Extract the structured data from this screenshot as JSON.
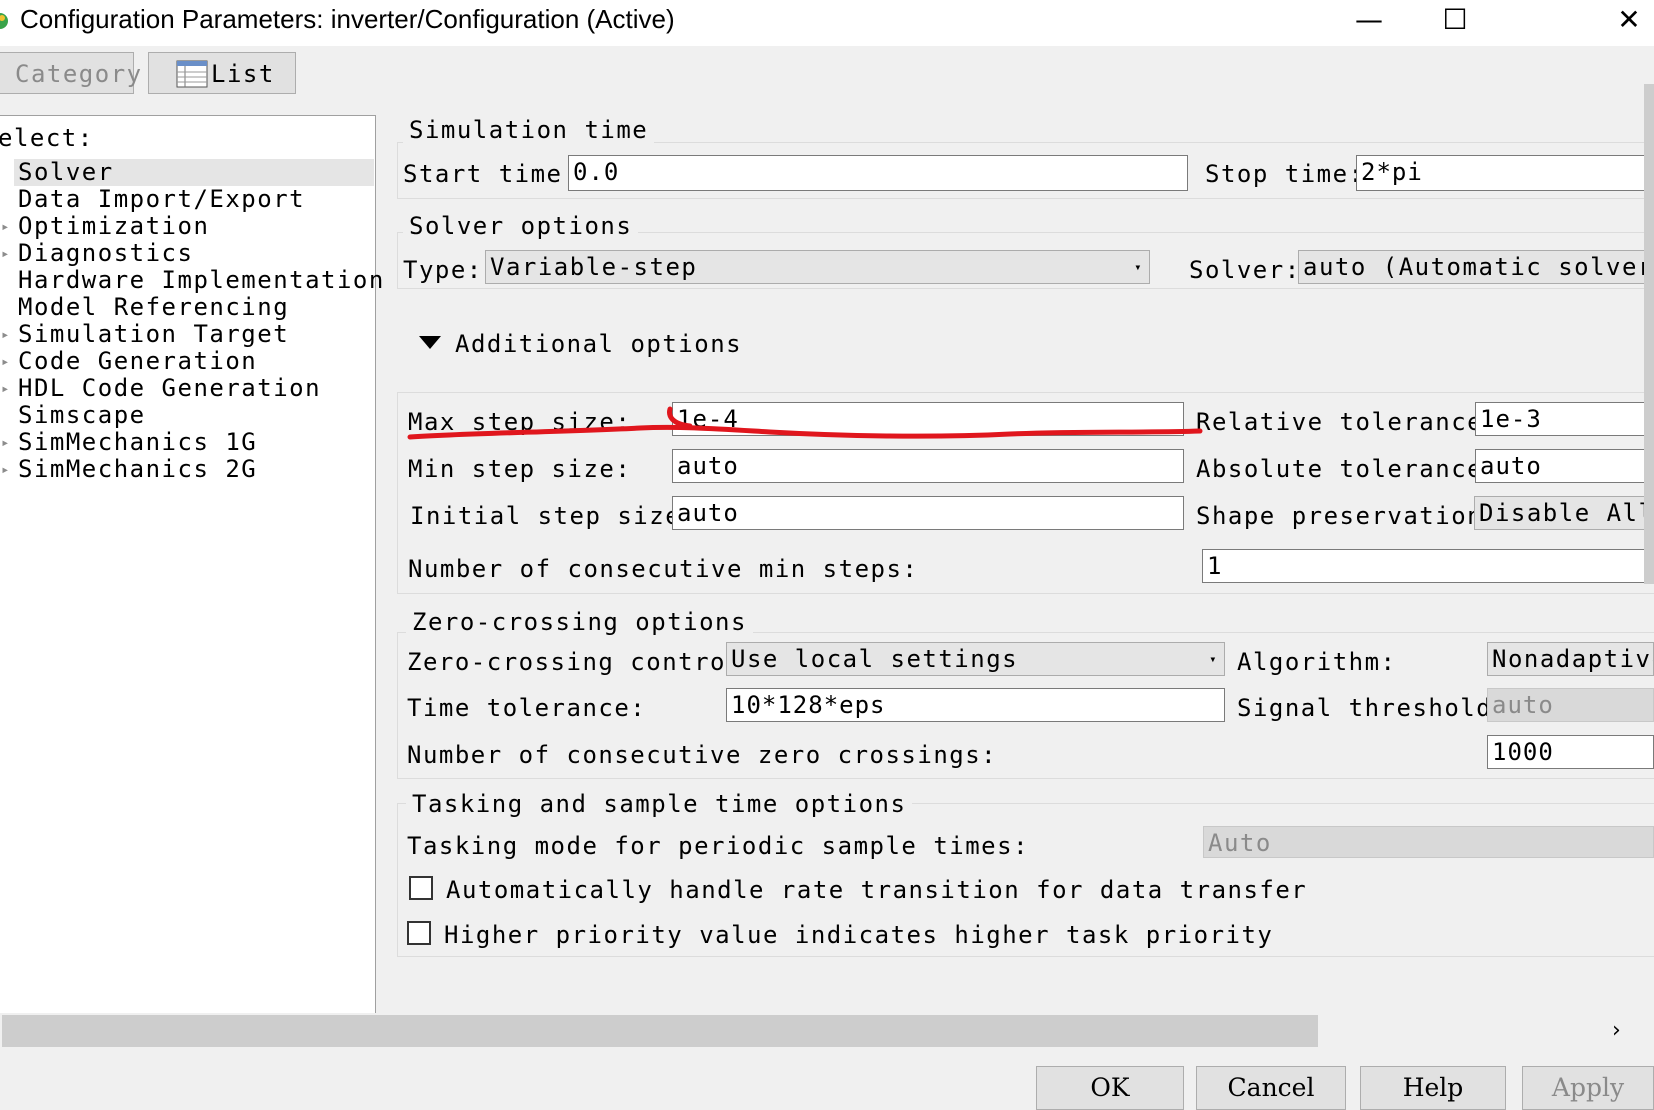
{
  "window": {
    "title": "Configuration Parameters: inverter/Configuration (Active)",
    "icon": "simulink-app-icon",
    "minimize": "—",
    "maximize": "☐",
    "close": "✕"
  },
  "toolbar": {
    "category": "Category",
    "list": "List"
  },
  "tree": {
    "header": "elect:",
    "items": [
      {
        "label": "Solver",
        "expandable": false,
        "selected": true
      },
      {
        "label": "Data Import/Export",
        "expandable": false
      },
      {
        "label": "Optimization",
        "expandable": true
      },
      {
        "label": "Diagnostics",
        "expandable": true
      },
      {
        "label": "Hardware Implementation",
        "expandable": false
      },
      {
        "label": "Model Referencing",
        "expandable": false
      },
      {
        "label": "Simulation Target",
        "expandable": true
      },
      {
        "label": "Code Generation",
        "expandable": true
      },
      {
        "label": "HDL Code Generation",
        "expandable": true
      },
      {
        "label": "Simscape",
        "expandable": false
      },
      {
        "label": "SimMechanics 1G",
        "expandable": true
      },
      {
        "label": "SimMechanics 2G",
        "expandable": true
      }
    ]
  },
  "sim_time": {
    "title": "Simulation time",
    "start_label": "Start time:",
    "start_value": "0.0",
    "stop_label": "Stop time:",
    "stop_value": "2*pi"
  },
  "solver_options": {
    "title": "Solver options",
    "type_label": "Type:",
    "type_value": "Variable-step",
    "solver_label": "Solver:",
    "solver_value": "auto (Automatic solver s",
    "additional_title": "Additional options",
    "max_step_label": "Max step size:",
    "max_step_value": "1e-4",
    "rel_tol_label": "Relative tolerance:",
    "rel_tol_value": "1e-3",
    "min_step_label": "Min step size:",
    "min_step_value": "auto",
    "abs_tol_label": "Absolute tolerance:",
    "abs_tol_value": "auto",
    "init_step_label": "Initial step size:",
    "init_step_value": "auto",
    "shape_label": "Shape preservation:",
    "shape_value": "Disable All",
    "consec_min_label": "Number of consecutive min steps:",
    "consec_min_value": "1"
  },
  "zero_crossing": {
    "title": "Zero-crossing options",
    "control_label": "Zero-crossing control:",
    "control_value": "Use local settings",
    "algorithm_label": "Algorithm:",
    "algorithm_value": "Nonadaptive",
    "time_tol_label": "Time tolerance:",
    "time_tol_value": "10*128*eps",
    "signal_label": "Signal threshold:",
    "signal_value": "auto",
    "consec_zc_label": "Number of consecutive zero crossings:",
    "consec_zc_value": "1000"
  },
  "tasking": {
    "title": "Tasking and sample time options",
    "mode_label": "Tasking mode for periodic sample times:",
    "mode_value": "Auto",
    "rate_transition_label": "Automatically handle rate transition for data transfer",
    "rate_transition_checked": false,
    "priority_label": "Higher priority value indicates higher task priority",
    "priority_checked": false
  },
  "buttons": {
    "ok": "OK",
    "cancel": "Cancel",
    "help": "Help",
    "apply": "Apply"
  },
  "scroll_right": "›",
  "annotation_color": "#e0161d"
}
